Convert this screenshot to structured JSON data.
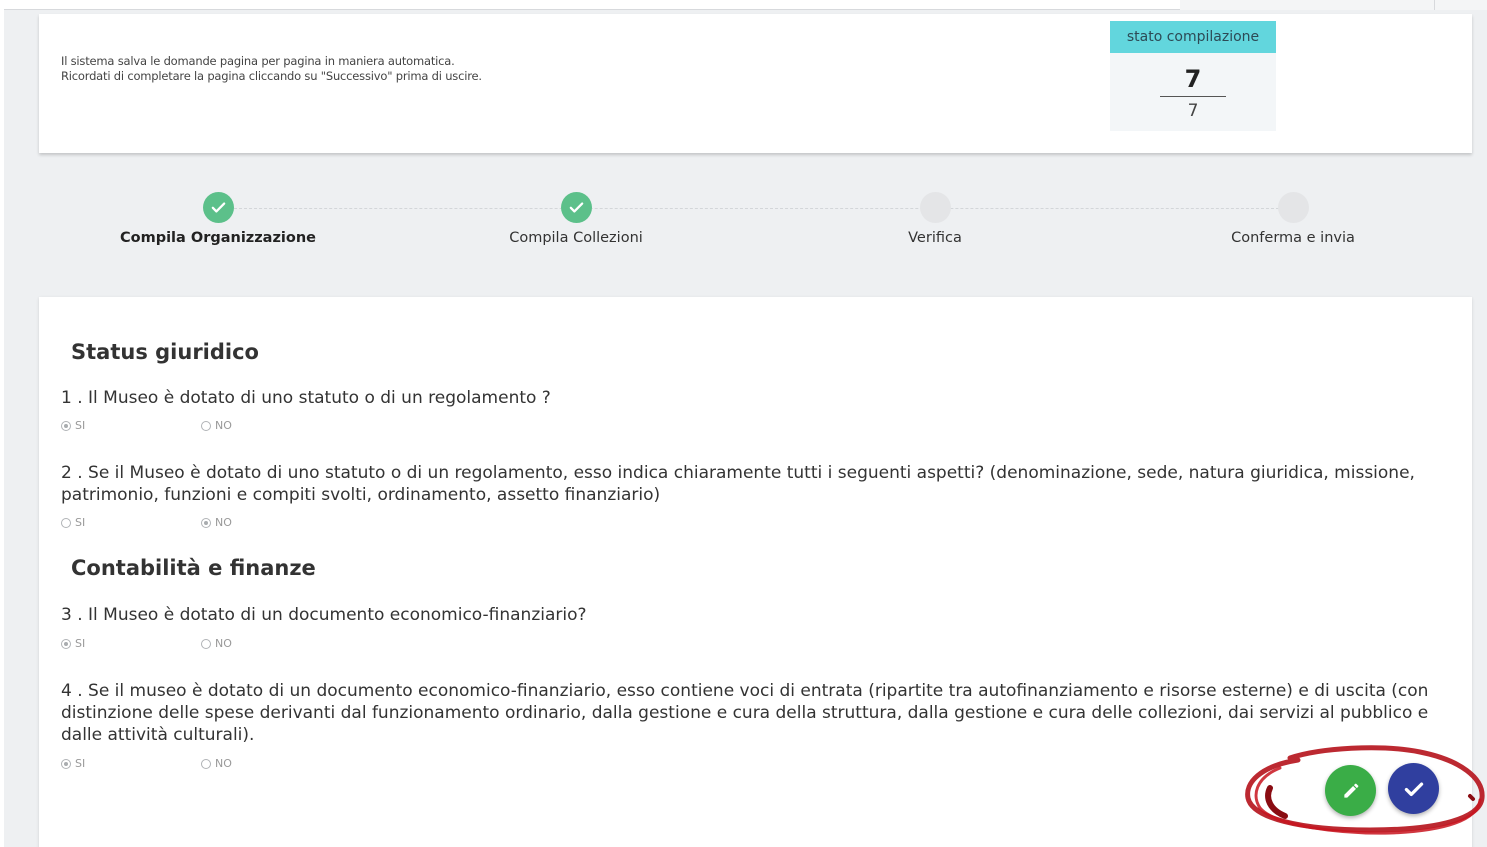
{
  "header": {
    "info_line1": "Il sistema salva le domande pagina per pagina in maniera automatica.",
    "info_line2": "Ricordati di completare la pagina cliccando su \"Successivo\" prima di uscire.",
    "status": {
      "label": "stato compilazione",
      "completed": "7",
      "total": "7"
    }
  },
  "stepper": {
    "steps": [
      {
        "label": "Compila Organizzazione",
        "done": true,
        "active": true
      },
      {
        "label": "Compila Collezioni",
        "done": true,
        "active": false
      },
      {
        "label": "Verifica",
        "done": false,
        "active": false
      },
      {
        "label": "Conferma e invia",
        "done": false,
        "active": false
      }
    ]
  },
  "form": {
    "sections": [
      {
        "title": "Status giuridico"
      },
      {
        "title": "Contabilità e finanze"
      }
    ],
    "option_yes": "SI",
    "option_no": "NO",
    "questions": [
      {
        "number": "1 .",
        "text": "Il Museo è dotato di uno statuto o di un regolamento ?",
        "selected": "SI"
      },
      {
        "number": "2 .",
        "text": "Se il Museo è dotato di uno statuto o di un regolamento, esso indica chiaramente tutti i seguenti aspetti? (denominazione, sede, natura giuridica, missione, patrimonio, funzioni e compiti svolti, ordinamento, assetto finanziario)",
        "selected": "NO"
      },
      {
        "number": "3 .",
        "text": "Il Museo è dotato di un documento economico-finanziario?",
        "selected": "SI"
      },
      {
        "number": "4 .",
        "text": "Se il museo è dotato di un documento economico-finanziario, esso contiene voci di entrata (ripartite tra autofinanziamento e risorse esterne) e di uscita (con distinzione delle spese derivanti dal funzionamento ordinario, dalla gestione e cura della struttura, dalla gestione e cura delle collezioni, dai servizi al pubblico e dalle attività culturali).",
        "selected": "SI"
      }
    ]
  },
  "actions": {
    "edit_icon": "pencil-icon",
    "confirm_icon": "check-icon",
    "edit_color": "#3aad47",
    "confirm_color": "#303f9f"
  }
}
